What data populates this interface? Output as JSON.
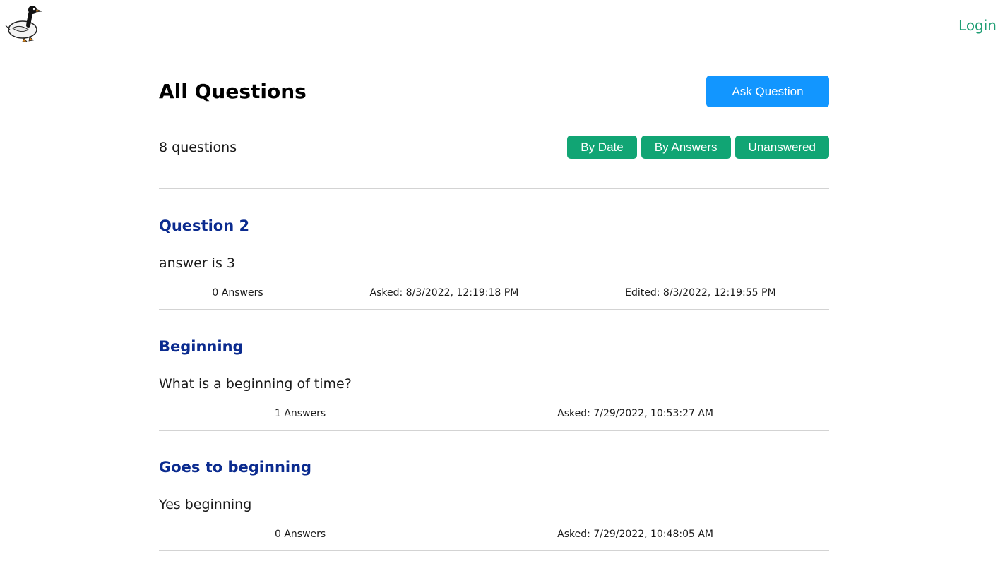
{
  "header": {
    "logo_icon": "goose-logo-icon",
    "login_label": "Login"
  },
  "main": {
    "title": "All Questions",
    "ask_button_label": "Ask Question",
    "question_count": "8 questions",
    "filters": [
      "By Date",
      "By Answers",
      "Unanswered"
    ]
  },
  "colors": {
    "ask_button": "#1296ff",
    "filter_button": "#11a574",
    "question_title": "#0b2b8f",
    "login_link": "#1f9e74"
  },
  "questions": [
    {
      "title": "Question 2",
      "body": "answer is 3",
      "answers": "0 Answers",
      "asked": "Asked: 8/3/2022, 12:19:18 PM",
      "edited": "Edited: 8/3/2022, 12:19:55 PM"
    },
    {
      "title": "Beginning",
      "body": "What is a beginning of time?",
      "answers": "1 Answers",
      "asked": "Asked: 7/29/2022, 10:53:27 AM"
    },
    {
      "title": "Goes to beginning",
      "body": "Yes beginning",
      "answers": "0 Answers",
      "asked": "Asked: 7/29/2022, 10:48:05 AM"
    }
  ]
}
